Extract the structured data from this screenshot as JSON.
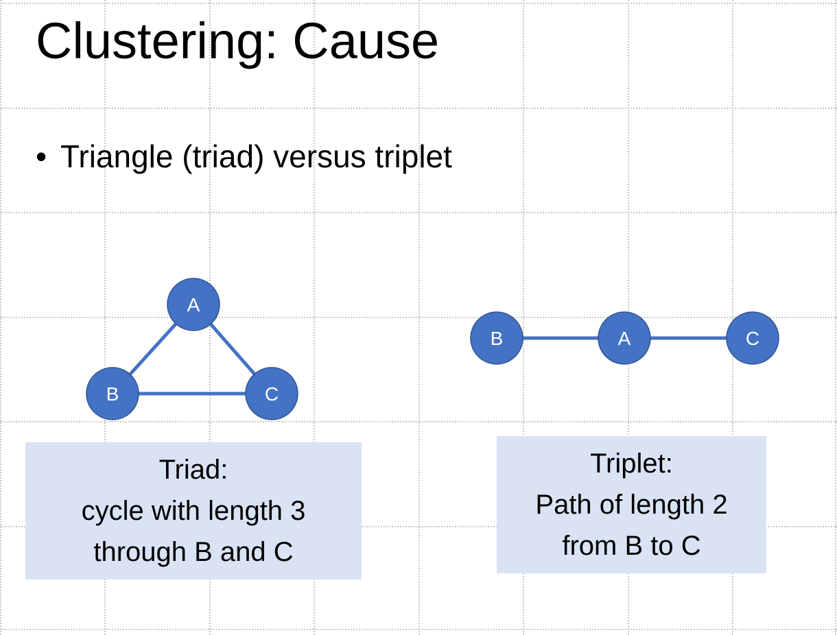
{
  "slide": {
    "title": "Clustering: Cause",
    "bullet": "Triangle (triad) versus triplet",
    "bullet_marker": "•"
  },
  "diagrams": {
    "triad": {
      "nodes": {
        "a": "A",
        "b": "B",
        "c": "C"
      },
      "caption": [
        "Triad:",
        "cycle with length 3",
        "through B and C"
      ]
    },
    "triplet": {
      "nodes": {
        "b": "B",
        "a": "A",
        "c": "C"
      },
      "caption": [
        "Triplet:",
        "Path of length 2",
        "from B to C"
      ]
    }
  },
  "colors": {
    "node_fill": "#4472c4",
    "node_stroke": "#2f528f",
    "edge": "#4472c4",
    "caption_bg": "#dae3f3",
    "grid": "#c8c8c8"
  }
}
